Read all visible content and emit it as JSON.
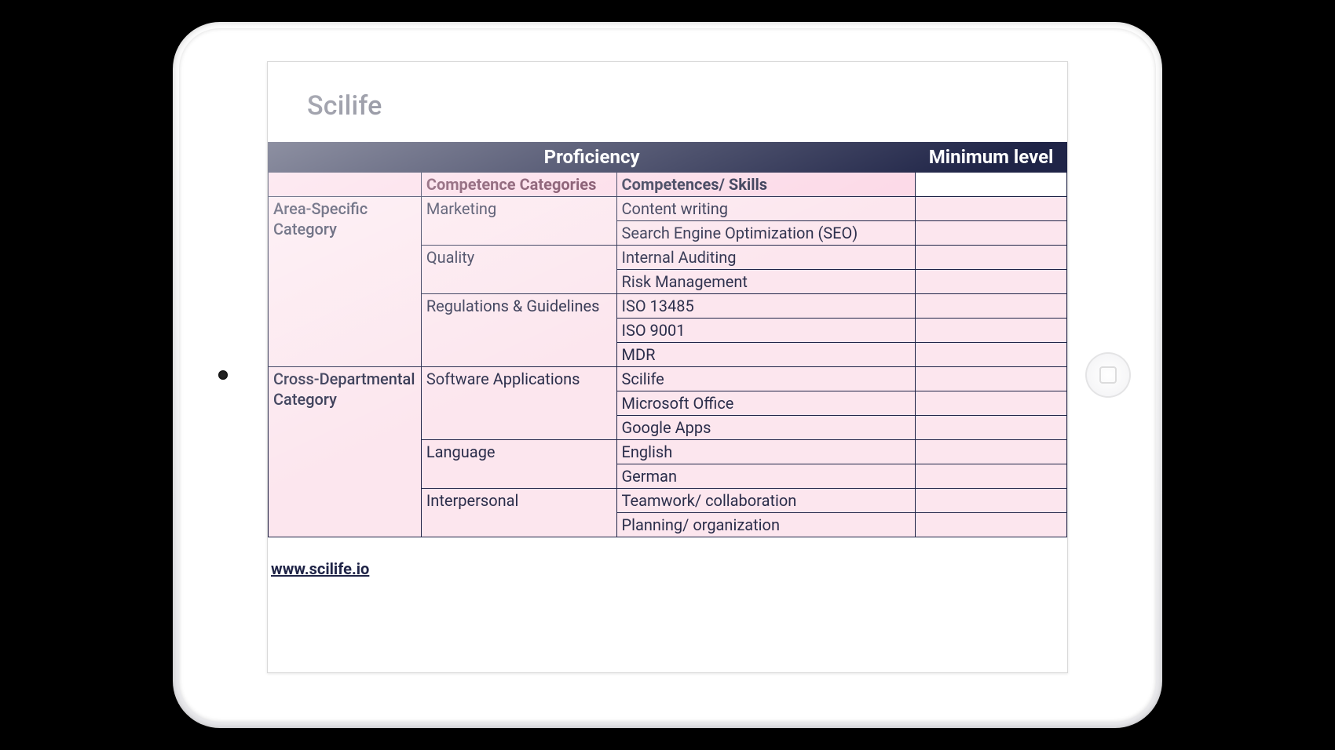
{
  "brand": "Scilife",
  "table": {
    "header": {
      "proficiency": "Proficiency",
      "min_level": "Minimum level",
      "competence_categories": "Competence Categories",
      "competences_skills": "Competences/ Skills"
    },
    "areas": [
      {
        "name": "Area-Specific Category",
        "groups": [
          {
            "category": "Marketing",
            "skills": [
              "Content writing",
              "Search Engine Optimization (SEO)"
            ]
          },
          {
            "category": "Quality",
            "skills": [
              "Internal Auditing",
              "Risk Management"
            ]
          },
          {
            "category": "Regulations & Guidelines",
            "skills": [
              "ISO 13485",
              "ISO 9001",
              "MDR"
            ]
          }
        ]
      },
      {
        "name": "Cross-Departmental Category",
        "groups": [
          {
            "category": "Software Applications",
            "skills": [
              "Scilife",
              "Microsoft Office",
              "Google Apps"
            ]
          },
          {
            "category": "Language",
            "skills": [
              "English",
              "German"
            ]
          },
          {
            "category": "Interpersonal",
            "skills": [
              "Teamwork/ collaboration",
              "Planning/ organization"
            ]
          }
        ]
      }
    ]
  },
  "footer_url": "www.scilife.io"
}
